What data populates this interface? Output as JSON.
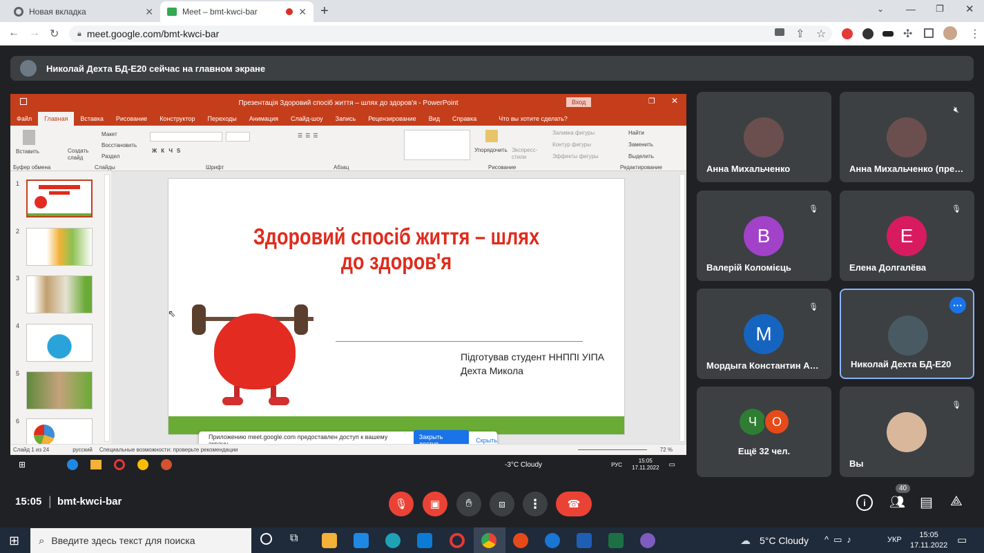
{
  "browser": {
    "tabs": [
      {
        "title": "Новая вкладка",
        "active": false
      },
      {
        "title": "Meet – bmt-kwci-bar",
        "active": true
      }
    ],
    "url": "meet.google.com/bmt-kwci-bar"
  },
  "meet": {
    "presenting_banner": "Николай Дехта БД-Е20 сейчас на главном экране",
    "time": "15:05",
    "meeting_code": "bmt-kwci-bar",
    "participants_count": "40",
    "tiles": [
      {
        "name": "Анна Михальченко",
        "initial": "",
        "color": "",
        "muted": false,
        "photo": true
      },
      {
        "name": "Анна Михальченко (пре…",
        "initial": "",
        "color": "",
        "muted": true,
        "photo": true
      },
      {
        "name": "Валерій Коломієць",
        "initial": "B",
        "color": "#a142c9",
        "muted": true
      },
      {
        "name": "Елена Долгалёва",
        "initial": "E",
        "color": "#d81b60",
        "muted": true
      },
      {
        "name": "Мордыга Константин А…",
        "initial": "M",
        "color": "#1565c0",
        "muted": true
      },
      {
        "name": "Николай Дехта БД-Е20",
        "initial": "",
        "color": "",
        "muted": false,
        "photo": true,
        "active": true
      },
      {
        "name": "Ещё 32 чел.",
        "initial": "",
        "muted": false
      },
      {
        "name": "Вы",
        "initial": "",
        "muted": true,
        "photo": true
      }
    ],
    "more_initials": [
      "Ч",
      "О"
    ]
  },
  "ppt": {
    "window_title": "Презентація Здоровий спосіб життя – шлях до здоров'я  -  PowerPoint",
    "login_label": "Вход",
    "menu": [
      "Файл",
      "Главная",
      "Вставка",
      "Рисование",
      "Конструктор",
      "Переходы",
      "Анимация",
      "Слайд-шоу",
      "Запись",
      "Рецензирование",
      "Вид",
      "Справка"
    ],
    "search_hint": "Что вы хотите сделать?",
    "groups": [
      "Буфер обмена",
      "Слайды",
      "Шрифт",
      "Абзац",
      "Рисование",
      "Редактирование"
    ],
    "ribbon_items": {
      "paste": "Вставить",
      "new_slide": "Создать слайд",
      "layout": "Макет",
      "reset": "Восстановить",
      "section": "Раздел",
      "arrange": "Упорядочить",
      "quick_styles": "Экспресс-стили",
      "fill": "Заливка фигуры",
      "outline": "Контур фигуры",
      "effects": "Эффекты фигуры",
      "find": "Найти",
      "replace": "Заменить",
      "select": "Выделить"
    },
    "slide_numbers": [
      "1",
      "2",
      "3",
      "4",
      "5",
      "6"
    ],
    "slide": {
      "title_line1": "Здоровий спосіб життя – шлях",
      "title_line2": "до здоров'я",
      "subtitle_line1": "Підготував студент ННППІ УІПА",
      "subtitle_line2": "Дехта Микола"
    },
    "status": {
      "slide_of": "Слайд 1 из 24",
      "language": "русский",
      "accessibility": "Специальные возможности: проверьте рекомендации",
      "zoom": "72 %"
    },
    "share_notice": "Приложению meet.google.com предоставлен доступ к вашему экрану.",
    "stop_share": "Закрыть доступ",
    "hide": "Скрыть",
    "inner_taskbar": {
      "weather": "-3°C  Cloudy",
      "lang": "РУС",
      "time": "15:05",
      "date": "17.11.2022"
    }
  },
  "windows": {
    "search_placeholder": "Введите здесь текст для поиска",
    "weather": "5°C  Cloudy",
    "lang": "УКР",
    "time": "15:05",
    "date": "17.11.2022"
  }
}
